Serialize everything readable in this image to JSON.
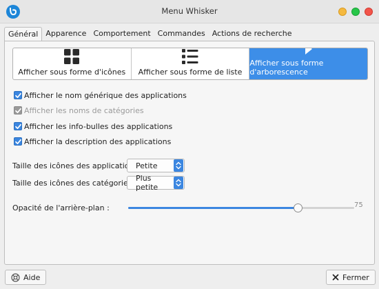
{
  "window": {
    "title": "Menu Whisker",
    "app_icon": "whisker-menu-icon"
  },
  "tabs": [
    {
      "label": "Général",
      "active": true
    },
    {
      "label": "Apparence",
      "active": false
    },
    {
      "label": "Comportement",
      "active": false
    },
    {
      "label": "Commandes",
      "active": false
    },
    {
      "label": "Actions de recherche",
      "active": false
    }
  ],
  "view_modes": [
    {
      "label": "Afficher sous forme d'icônes",
      "icon": "grid-icon",
      "selected": false
    },
    {
      "label": "Afficher sous forme de liste",
      "icon": "list-icon",
      "selected": false
    },
    {
      "label": "Afficher sous forme d'arborescence",
      "icon": "tree-arrow-icon",
      "selected": true
    }
  ],
  "options": [
    {
      "label": "Afficher le nom générique des applications",
      "checked": true,
      "enabled": true
    },
    {
      "label": "Afficher les noms de catégories",
      "checked": true,
      "enabled": false
    },
    {
      "label": "Afficher les info-bulles des applications",
      "checked": true,
      "enabled": true
    },
    {
      "label": "Afficher la description des applications",
      "checked": true,
      "enabled": true
    }
  ],
  "app_icon_size": {
    "label": "Taille des icônes des applications :",
    "value": "Petite"
  },
  "category_icon_size": {
    "label": "Taille des icônes des catégories :",
    "value": "Plus petite"
  },
  "opacity": {
    "label": "Opacité de l'arrière-plan :",
    "value": 75,
    "max": 100
  },
  "footer": {
    "help_label": "Aide",
    "close_label": "Fermer"
  },
  "colors": {
    "accent": "#3b86e0",
    "close_button": "#f2544a",
    "maximize_button": "#27c649",
    "minimize_button": "#f5b93f"
  }
}
